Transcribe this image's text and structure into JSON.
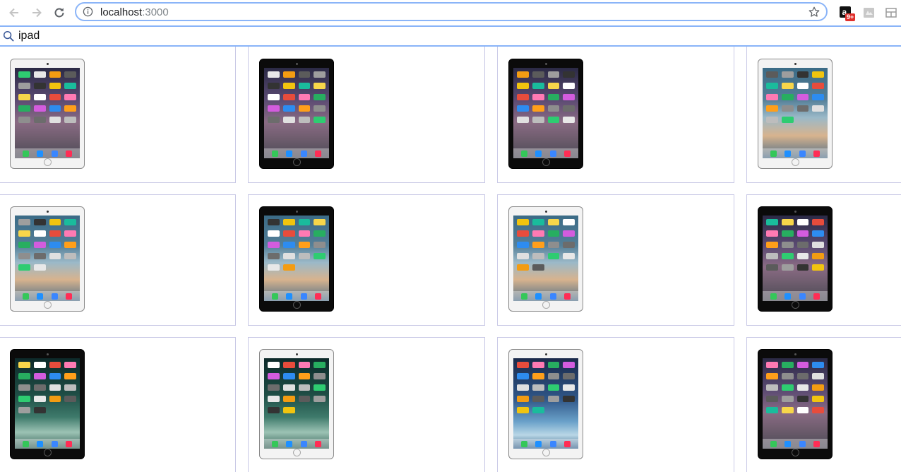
{
  "browser": {
    "address": {
      "host": "localhost",
      "port": ":3000"
    },
    "extensions": [
      {
        "name": "amazon-extension",
        "badge": "9+"
      },
      {
        "name": "image-extension"
      },
      {
        "name": "layout-extension"
      }
    ]
  },
  "search": {
    "query": "ipad"
  },
  "results": [
    {
      "finish": "silver",
      "wallpaper": "galaxy"
    },
    {
      "finish": "black",
      "wallpaper": "galaxy"
    },
    {
      "finish": "black",
      "wallpaper": "galaxy"
    },
    {
      "finish": "silver",
      "wallpaper": "blue"
    },
    {
      "finish": "silver",
      "wallpaper": "blue"
    },
    {
      "finish": "black",
      "wallpaper": "blue"
    },
    {
      "finish": "silver",
      "wallpaper": "blue"
    },
    {
      "finish": "black",
      "wallpaper": "galaxy"
    },
    {
      "finish": "black",
      "wallpaper": "green"
    },
    {
      "finish": "silver",
      "wallpaper": "green"
    },
    {
      "finish": "silver",
      "wallpaper": "ocean"
    },
    {
      "finish": "black",
      "wallpaper": "galaxy"
    }
  ],
  "colors": {
    "accent": "#8ab4f8",
    "card_border": "#c9c9e6",
    "badge": "#e0302c"
  }
}
